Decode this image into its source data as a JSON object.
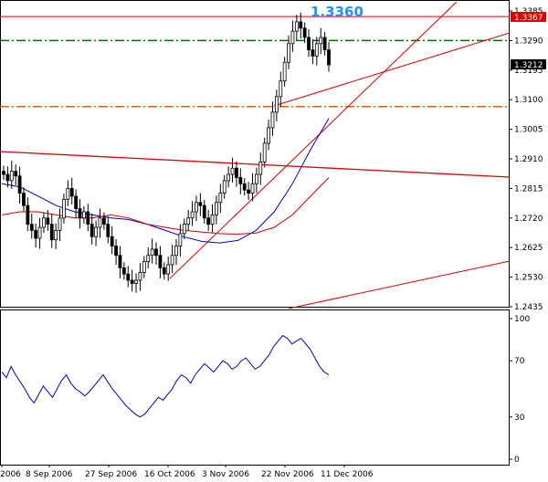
{
  "chart_data": {
    "type": "candlestick",
    "instrument_panel": {
      "y_ticks": [
        "1.3385",
        "1.3290",
        "1.3195",
        "1.3100",
        "1.3005",
        "1.2910",
        "1.2815",
        "1.2720",
        "1.2625",
        "1.2530",
        "1.2435"
      ],
      "y_tick_values": [
        1.3385,
        1.329,
        1.3195,
        1.31,
        1.3005,
        1.291,
        1.2815,
        1.272,
        1.2625,
        1.253,
        1.2435
      ],
      "ylim": [
        1.2435,
        1.3385
      ],
      "price_label_high": "1.3367",
      "price_label_current": "1.3212",
      "annotation": "1.3360",
      "annotation_color": "#1e90ff",
      "horizontal_lines": [
        {
          "value": 1.3367,
          "style": "solid",
          "color": "#e00000"
        },
        {
          "value": 1.329,
          "style": "dash-dot",
          "color": "#007000"
        },
        {
          "value": 1.3078,
          "style": "dash-dot",
          "color": "#e06000"
        }
      ],
      "candle_count": 130,
      "candle_close_path": [
        1.286,
        1.284,
        1.287,
        1.2855,
        1.28,
        1.276,
        1.27,
        1.268,
        1.2655,
        1.269,
        1.272,
        1.27,
        1.265,
        1.268,
        1.272,
        1.278,
        1.2815,
        1.279,
        1.275,
        1.272,
        1.274,
        1.27,
        1.266,
        1.269,
        1.272,
        1.27,
        1.266,
        1.263,
        1.26,
        1.256,
        1.254,
        1.252,
        1.251,
        1.252,
        1.2545,
        1.258,
        1.26,
        1.262,
        1.26,
        1.256,
        1.254,
        1.257,
        1.26,
        1.263,
        1.267,
        1.27,
        1.272,
        1.274,
        1.277,
        1.276,
        1.272,
        1.27,
        1.273,
        1.277,
        1.28,
        1.284,
        1.286,
        1.288,
        1.285,
        1.283,
        1.281,
        1.28,
        1.283,
        1.286,
        1.29,
        1.296,
        1.301,
        1.306,
        1.311,
        1.316,
        1.322,
        1.328,
        1.332,
        1.335,
        1.333,
        1.33,
        1.326,
        1.324,
        1.328,
        1.33,
        1.326,
        1.3212
      ],
      "indicator_lines": [
        {
          "color": "#0000cc",
          "path": [
            1.283,
            1.282,
            1.279,
            1.276,
            1.274,
            1.273,
            1.272,
            1.2715,
            1.27,
            1.268,
            1.266,
            1.2645,
            1.264,
            1.2648,
            1.268,
            1.274,
            1.283,
            1.294,
            1.304
          ]
        },
        {
          "color": "#cc0000",
          "path": [
            1.273,
            1.274,
            1.274,
            1.273,
            1.272,
            1.272,
            1.273,
            1.272,
            1.27,
            1.269,
            1.268,
            1.2675,
            1.267,
            1.2668,
            1.2672,
            1.269,
            1.273,
            1.279,
            1.285
          ]
        }
      ]
    },
    "oscillator_panel": {
      "y_ticks": [
        "100",
        "70",
        "30",
        "0"
      ],
      "y_tick_values": [
        100,
        70,
        30,
        0
      ],
      "ylim": [
        0,
        100
      ],
      "line_color": "#0000cc",
      "values": [
        62,
        58,
        66,
        60,
        55,
        50,
        44,
        40,
        46,
        52,
        48,
        44,
        50,
        56,
        60,
        54,
        50,
        48,
        45,
        48,
        52,
        56,
        60,
        55,
        50,
        46,
        42,
        38,
        35,
        32,
        30,
        32,
        36,
        40,
        44,
        42,
        46,
        50,
        56,
        60,
        58,
        54,
        60,
        64,
        68,
        65,
        62,
        66,
        70,
        68,
        64,
        66,
        70,
        72,
        68,
        64,
        66,
        70,
        74,
        80,
        84,
        88,
        86,
        82,
        84,
        86,
        82,
        78,
        72,
        66,
        62,
        60
      ]
    },
    "x_tick_labels": [
      "2006",
      "8 Sep 2006",
      "27 Sep 2006",
      "16 Oct 2006",
      "3 Nov 2006",
      "22 Nov 2006",
      "11 Dec 2006"
    ]
  }
}
